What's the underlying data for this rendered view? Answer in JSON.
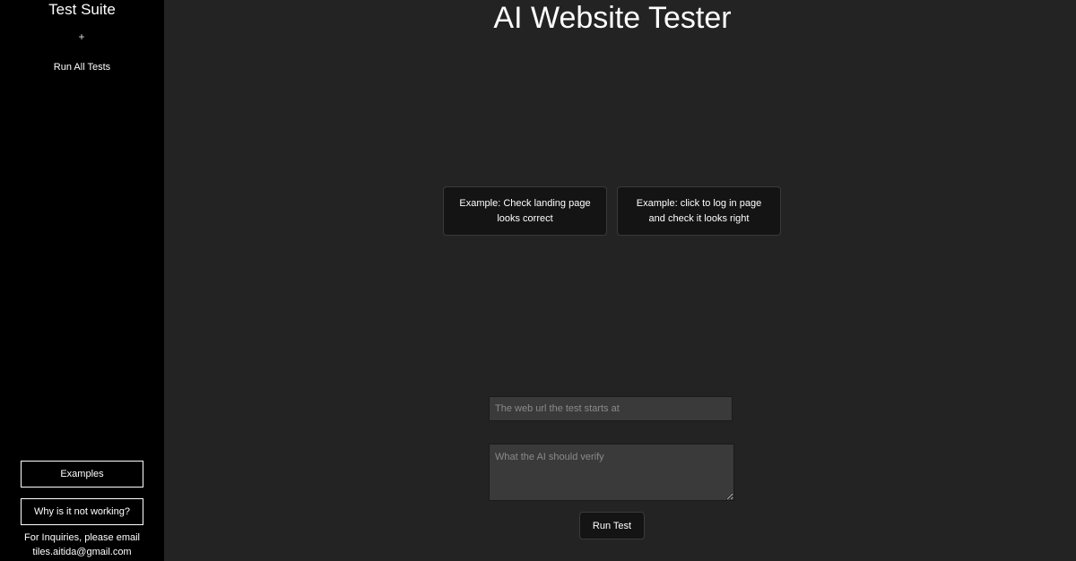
{
  "sidebar": {
    "title": "Test Suite",
    "add_label": "+",
    "run_all_label": "Run All Tests",
    "examples_label": "Examples",
    "why_label": "Why is it not working?",
    "inquiries_line1": "For Inquiries, please email",
    "inquiries_email": "tiles.aitida@gmail.com"
  },
  "main": {
    "title": "AI Website Tester",
    "examples": [
      {
        "label": "Example: Check landing page looks correct"
      },
      {
        "label": "Example: click to log in page and check it looks right"
      }
    ],
    "url_placeholder": "The web url the test starts at",
    "verify_placeholder": "What the AI should verify",
    "run_test_label": "Run Test"
  },
  "colors": {
    "sidebar_bg": "#000000",
    "main_bg": "#232323",
    "card_bg": "#141414",
    "input_bg": "#3a3a3a",
    "text": "#ffffff"
  }
}
